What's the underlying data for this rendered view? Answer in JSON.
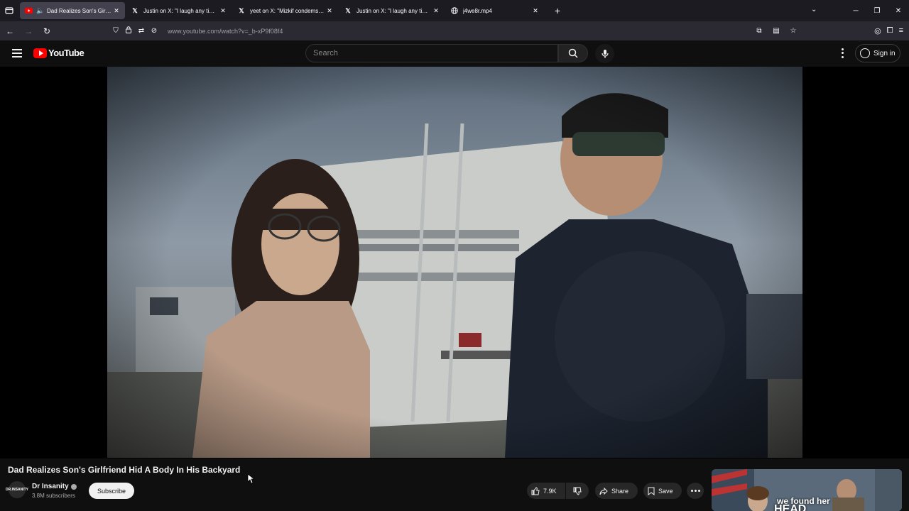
{
  "browser": {
    "tabs": [
      {
        "title": "Dad Realizes Son's Girlfrien",
        "favicon": "youtube-icon",
        "active": true
      },
      {
        "title": "Justin on X: \"I laugh any time th",
        "favicon": "x-icon",
        "active": false
      },
      {
        "title": "yeet on X: \"Mizkif condems Poki",
        "favicon": "x-icon",
        "active": false
      },
      {
        "title": "Justin on X: \"I laugh any time th",
        "favicon": "x-icon",
        "active": false
      },
      {
        "title": "j4we8r.mp4",
        "favicon": "globe-icon",
        "active": false
      }
    ],
    "url": "www.youtube.com/watch?v=_b-xP9f08f4"
  },
  "youtube": {
    "logo_text": "YouTube",
    "search_placeholder": "Search",
    "sign_in": "Sign in"
  },
  "video": {
    "title": "Dad Realizes Son's Girlfriend Hid A Body In His Backyard",
    "channel_name": "Dr Insanity",
    "channel_avatar_text": "DR.INSANITY",
    "subscribers": "3.8M subscribers",
    "subscribe_label": "Subscribe",
    "likes": "7.9K",
    "share_label": "Share",
    "save_label": "Save"
  },
  "recommended": {
    "thumbnail_text_1": "we found her",
    "thumbnail_text_2": "HEAD"
  },
  "colors": {
    "brand_red": "#ff0000",
    "background": "#0f0f0f",
    "tab_active": "#42414d",
    "toolbar": "#2b2a33"
  }
}
